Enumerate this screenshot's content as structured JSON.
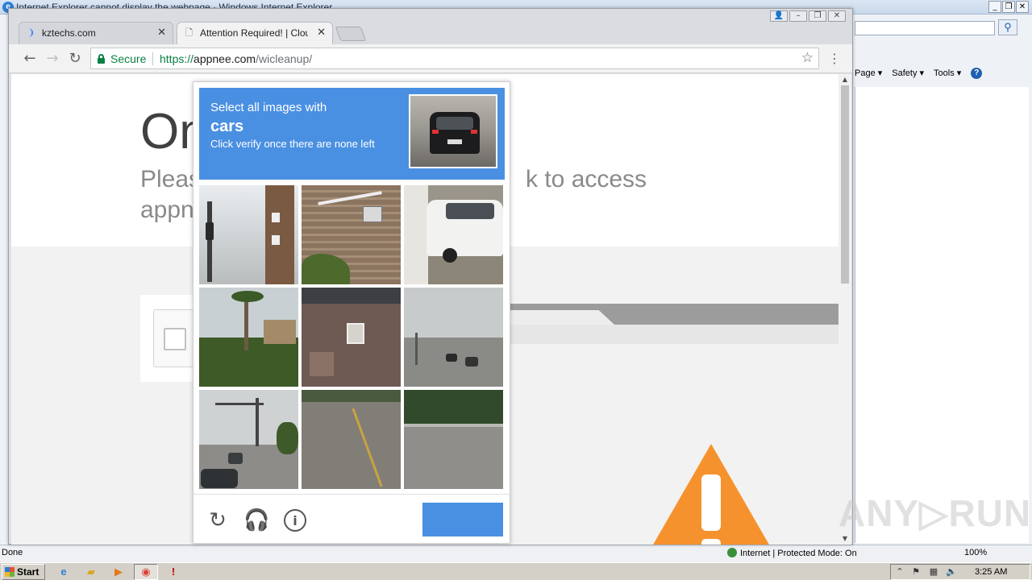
{
  "ie": {
    "title": "Internet Explorer cannot display the webpage - Windows Internet Explorer",
    "commandbar": [
      "Page ▾",
      "Safety ▾",
      "Tools ▾"
    ],
    "status_left": "Done",
    "status_zone": "Internet | Protected Mode: On",
    "zoom": "100%"
  },
  "chrome": {
    "tabs": [
      {
        "label": "kztechs.com",
        "active": false
      },
      {
        "label": "Attention Required! | Cloud",
        "active": true
      }
    ],
    "secure_label": "Secure",
    "url": {
      "scheme": "https://",
      "host": "appnee.com",
      "path": "/wicleanup/"
    }
  },
  "page": {
    "heading": "On",
    "text_line1_left": "Pleas",
    "text_line1_right": "k to access",
    "text_line2": "appn"
  },
  "recaptcha": {
    "line1": "Select all images with",
    "target": "cars",
    "line3": "Click verify once there are none left",
    "verify_label": "",
    "tiles": [
      {
        "name": "tile-traffic-light-pole"
      },
      {
        "name": "tile-brick-wall-sign"
      },
      {
        "name": "tile-white-car"
      },
      {
        "name": "tile-palm-trees"
      },
      {
        "name": "tile-brick-building"
      },
      {
        "name": "tile-road-with-cars"
      },
      {
        "name": "tile-intersection-cars"
      },
      {
        "name": "tile-empty-road"
      },
      {
        "name": "tile-road-trees"
      }
    ]
  },
  "watermark": "ANY▷RUN",
  "taskbar": {
    "start_label": "Start",
    "clock": "3:25 AM"
  },
  "colors": {
    "captcha_blue": "#4a90e2",
    "secure_green": "#0b8043",
    "warning_orange": "#f6922d"
  }
}
